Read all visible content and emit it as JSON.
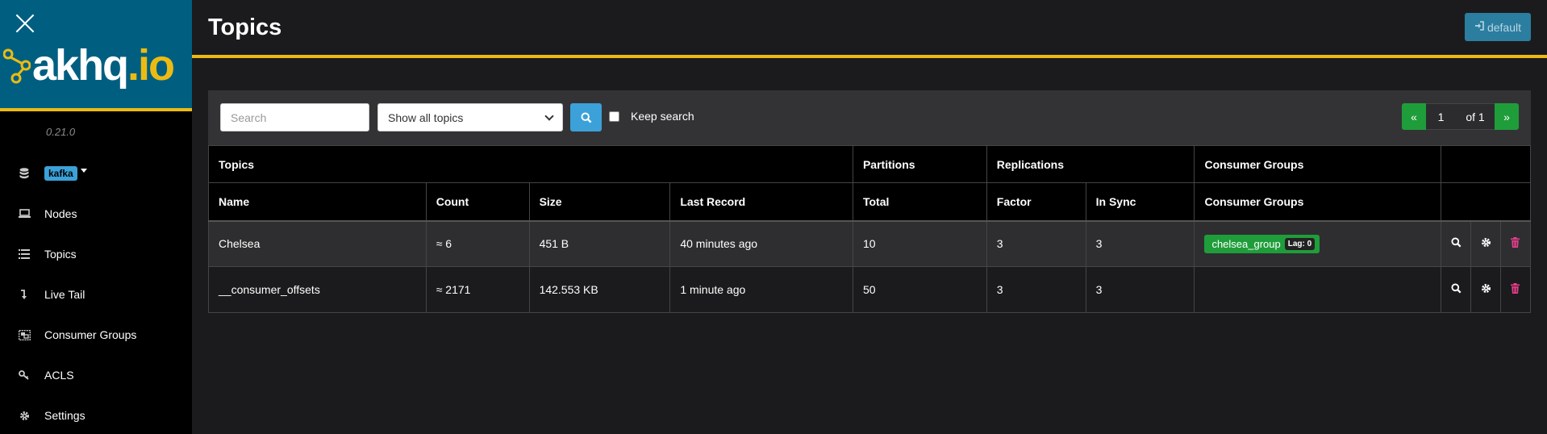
{
  "sidebar": {
    "version": "0.21.0",
    "logo": {
      "text_white": "akhq",
      "text_yellow": ".io"
    },
    "cluster": "kafka",
    "items": [
      {
        "label": "Nodes",
        "icon": "laptop-icon"
      },
      {
        "label": "Topics",
        "icon": "list-icon"
      },
      {
        "label": "Live Tail",
        "icon": "level-down-icon"
      },
      {
        "label": "Consumer Groups",
        "icon": "object-group-icon"
      },
      {
        "label": "ACLS",
        "icon": "key-icon"
      },
      {
        "label": "Settings",
        "icon": "cog-icon"
      }
    ]
  },
  "header": {
    "title": "Topics",
    "login_label": "default"
  },
  "filters": {
    "search_placeholder": "Search",
    "select_value": "Show all topics",
    "keep_search_label": "Keep search"
  },
  "pagination": {
    "prev": "«",
    "current": "1",
    "of": "of 1",
    "next": "»"
  },
  "table": {
    "groups": [
      "Topics",
      "Partitions",
      "Replications",
      "Consumer Groups"
    ],
    "headers": [
      "Name",
      "Count",
      "Size",
      "Last Record",
      "Total",
      "Factor",
      "In Sync",
      "Consumer Groups"
    ],
    "rows": [
      {
        "name": "Chelsea",
        "count": "≈ 6",
        "size": "451 B",
        "last_record": "40 minutes ago",
        "total": "10",
        "factor": "3",
        "in_sync": "3",
        "consumer_group": "chelsea_group",
        "lag": "Lag: 0"
      },
      {
        "name": "__consumer_offsets",
        "count": "≈ 2171",
        "size": "142.553 KB",
        "last_record": "1 minute ago",
        "total": "50",
        "factor": "3",
        "in_sync": "3",
        "consumer_group": "",
        "lag": ""
      }
    ]
  },
  "colors": {
    "accent_yellow": "#ecbb13",
    "brand_blue": "#005f81",
    "success_green": "#1f9d3a",
    "info_blue": "#3ca1d9",
    "danger_pink": "#e83e8c"
  }
}
